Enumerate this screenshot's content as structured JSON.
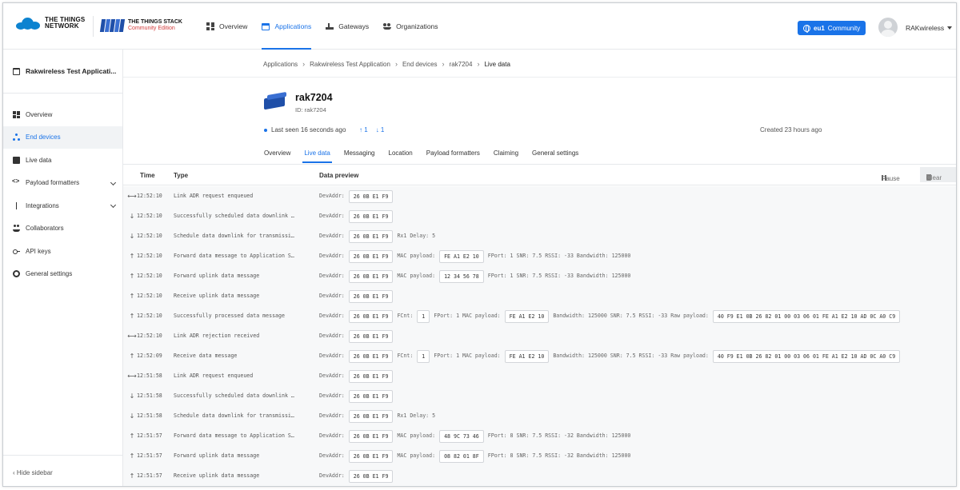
{
  "header": {
    "ttn_logo_line1": "THE THINGS",
    "ttn_logo_line2": "NETWORK",
    "stack_logo_line1": "THE THINGS STACK",
    "stack_logo_line2": "Community Edition",
    "nav": [
      {
        "label": "Overview",
        "icon": "grid-icon"
      },
      {
        "label": "Applications",
        "icon": "application-icon",
        "active": true
      },
      {
        "label": "Gateways",
        "icon": "gateway-icon"
      },
      {
        "label": "Organizations",
        "icon": "organization-icon"
      }
    ],
    "cluster_region": "eu1",
    "cluster_label": "Community",
    "username": "RAKwireless"
  },
  "sidebar": {
    "app_name": "Rakwireless Test Applicati...",
    "items": [
      {
        "label": "Overview",
        "icon": "dashboard-icon"
      },
      {
        "label": "End devices",
        "icon": "end-devices-icon",
        "active": true
      },
      {
        "label": "Live data",
        "icon": "live-data-icon"
      },
      {
        "label": "Payload formatters",
        "icon": "code-icon",
        "expandable": true
      },
      {
        "label": "Integrations",
        "icon": "integrations-icon",
        "expandable": true
      },
      {
        "label": "Collaborators",
        "icon": "collaborators-icon"
      },
      {
        "label": "API keys",
        "icon": "key-icon"
      },
      {
        "label": "General settings",
        "icon": "gear-icon"
      }
    ],
    "hide_label": "Hide sidebar"
  },
  "breadcrumb": [
    "Applications",
    "Rakwireless Test Application",
    "End devices",
    "rak7204",
    "Live data"
  ],
  "device": {
    "name": "rak7204",
    "id_label": "ID: rak7204",
    "last_seen": "Last seen 16 seconds ago",
    "uplink_count": "1",
    "downlink_count": "1",
    "created": "Created 23 hours ago"
  },
  "tabs": [
    "Overview",
    "Live data",
    "Messaging",
    "Location",
    "Payload formatters",
    "Claiming",
    "General settings"
  ],
  "live_data": {
    "col_time": "Time",
    "col_type": "Type",
    "col_preview": "Data preview",
    "pause_label": "Pause",
    "clear_label": "Clear",
    "rows": [
      {
        "dir": "⟷",
        "time": "12:52:10",
        "type": "Link ADR request enqueued",
        "preview": [
          [
            "DevAddr:",
            "26 0B E1 F9"
          ]
        ]
      },
      {
        "dir": "↓",
        "time": "12:52:10",
        "type": "Successfully scheduled data downlink …",
        "preview": [
          [
            "DevAddr:",
            "26 0B E1 F9"
          ]
        ]
      },
      {
        "dir": "↓",
        "time": "12:52:10",
        "type": "Schedule data downlink for transmissi…",
        "preview": [
          [
            "DevAddr:",
            "26 0B E1 F9"
          ],
          [
            "Rx1 Delay: 5",
            null
          ]
        ]
      },
      {
        "dir": "↑",
        "time": "12:52:10",
        "type": "Forward data message to Application S…",
        "preview": [
          [
            "DevAddr:",
            "26 0B E1 F9"
          ],
          [
            "MAC payload:",
            "FE A1 E2 10"
          ],
          [
            "FPort: 1  SNR: 7.5  RSSI: -33  Bandwidth: 125000",
            null
          ]
        ]
      },
      {
        "dir": "↑",
        "time": "12:52:10",
        "type": "Forward uplink data message",
        "preview": [
          [
            "DevAddr:",
            "26 0B E1 F9"
          ],
          [
            "MAC payload:",
            "12 34 56 78"
          ],
          [
            "FPort: 1  SNR: 7.5  RSSI: -33  Bandwidth: 125000",
            null
          ]
        ]
      },
      {
        "dir": "↑",
        "time": "12:52:10",
        "type": "Receive uplink data message",
        "preview": [
          [
            "DevAddr:",
            "26 0B E1 F9"
          ]
        ]
      },
      {
        "dir": "↑",
        "time": "12:52:10",
        "type": "Successfully processed data message",
        "preview": [
          [
            "DevAddr:",
            "26 0B E1 F9"
          ],
          [
            "FCnt:",
            "1"
          ],
          [
            "FPort: 1  MAC payload:",
            "FE A1 E2 10"
          ],
          [
            "Bandwidth: 125000  SNR: 7.5  RSSI: -33  Raw payload:",
            "40 F9 E1 0B 26 82 01 00 03 06 01 FE A1 E2 10 AD 0C A0 C9"
          ]
        ]
      },
      {
        "dir": "⟷",
        "time": "12:52:10",
        "type": "Link ADR rejection received",
        "preview": [
          [
            "DevAddr:",
            "26 0B E1 F9"
          ]
        ]
      },
      {
        "dir": "↑",
        "time": "12:52:09",
        "type": "Receive data message",
        "preview": [
          [
            "DevAddr:",
            "26 0B E1 F9"
          ],
          [
            "FCnt:",
            "1"
          ],
          [
            "FPort: 1  MAC payload:",
            "FE A1 E2 10"
          ],
          [
            "Bandwidth: 125000  SNR: 7.5  RSSI: -33  Raw payload:",
            "40 F9 E1 0B 26 82 01 00 03 06 01 FE A1 E2 10 AD 0C A0 C9"
          ]
        ]
      },
      {
        "dir": "⟷",
        "time": "12:51:58",
        "type": "Link ADR request enqueued",
        "preview": [
          [
            "DevAddr:",
            "26 0B E1 F9"
          ]
        ]
      },
      {
        "dir": "↓",
        "time": "12:51:58",
        "type": "Successfully scheduled data downlink …",
        "preview": [
          [
            "DevAddr:",
            "26 0B E1 F9"
          ]
        ]
      },
      {
        "dir": "↓",
        "time": "12:51:58",
        "type": "Schedule data downlink for transmissi…",
        "preview": [
          [
            "DevAddr:",
            "26 0B E1 F9"
          ],
          [
            "Rx1 Delay: 5",
            null
          ]
        ]
      },
      {
        "dir": "↑",
        "time": "12:51:57",
        "type": "Forward data message to Application S…",
        "preview": [
          [
            "DevAddr:",
            "26 0B E1 F9"
          ],
          [
            "MAC payload:",
            "48 9C 73 46"
          ],
          [
            "FPort: 8  SNR: 7.5  RSSI: -32  Bandwidth: 125000",
            null
          ]
        ]
      },
      {
        "dir": "↑",
        "time": "12:51:57",
        "type": "Forward uplink data message",
        "preview": [
          [
            "DevAddr:",
            "26 0B E1 F9"
          ],
          [
            "MAC payload:",
            "08 82 01 8F"
          ],
          [
            "FPort: 8  SNR: 7.5  RSSI: -32  Bandwidth: 125000",
            null
          ]
        ]
      },
      {
        "dir": "↑",
        "time": "12:51:57",
        "type": "Receive uplink data message",
        "preview": [
          [
            "DevAddr:",
            "26 0B E1 F9"
          ]
        ]
      }
    ]
  },
  "colors": {
    "accent": "#1a73e8",
    "brand_red": "#d23b3b"
  }
}
